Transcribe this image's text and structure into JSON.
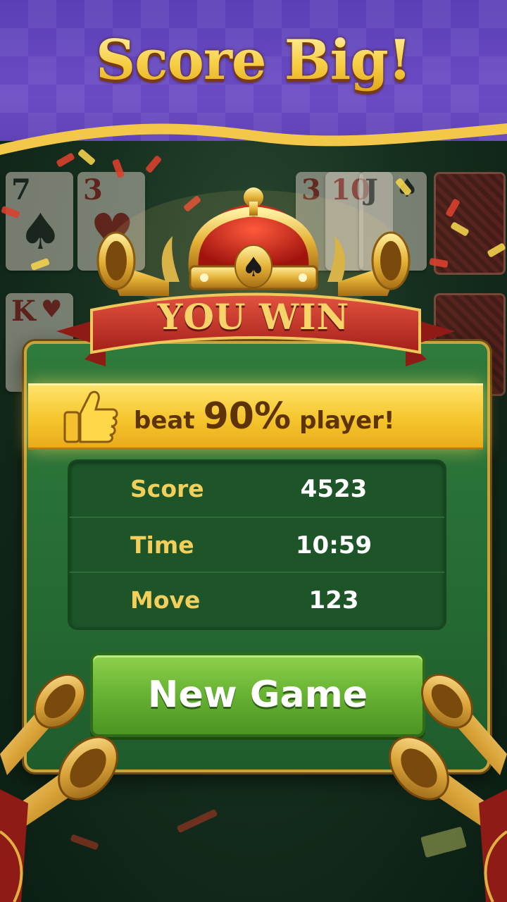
{
  "banner": {
    "headline": "Score Big!"
  },
  "result": {
    "title": "YOU WIN",
    "beat_prefix": "beat",
    "beat_percent": "90%",
    "beat_suffix": "player!"
  },
  "stats": [
    {
      "label": "Score",
      "value": "4523"
    },
    {
      "label": "Time",
      "value": "10:59"
    },
    {
      "label": "Move",
      "value": "123"
    }
  ],
  "actions": {
    "new_game": "New Game"
  },
  "background_cards": [
    {
      "rank": "7",
      "suit": "♠",
      "color": "black"
    },
    {
      "rank": "3",
      "suit": "♥",
      "color": "red"
    },
    {
      "rank": "3",
      "suit": "",
      "color": "red"
    },
    {
      "rank": "10",
      "suit": "",
      "color": "red"
    },
    {
      "rank": "J",
      "suit": "♠",
      "color": "black"
    },
    {
      "rank": "K",
      "suit": "♥",
      "color": "red"
    }
  ],
  "colors": {
    "banner_purple": "#6b4bc4",
    "felt_green": "#256a33",
    "gold": "#f7cf45",
    "button_green": "#66b232"
  }
}
